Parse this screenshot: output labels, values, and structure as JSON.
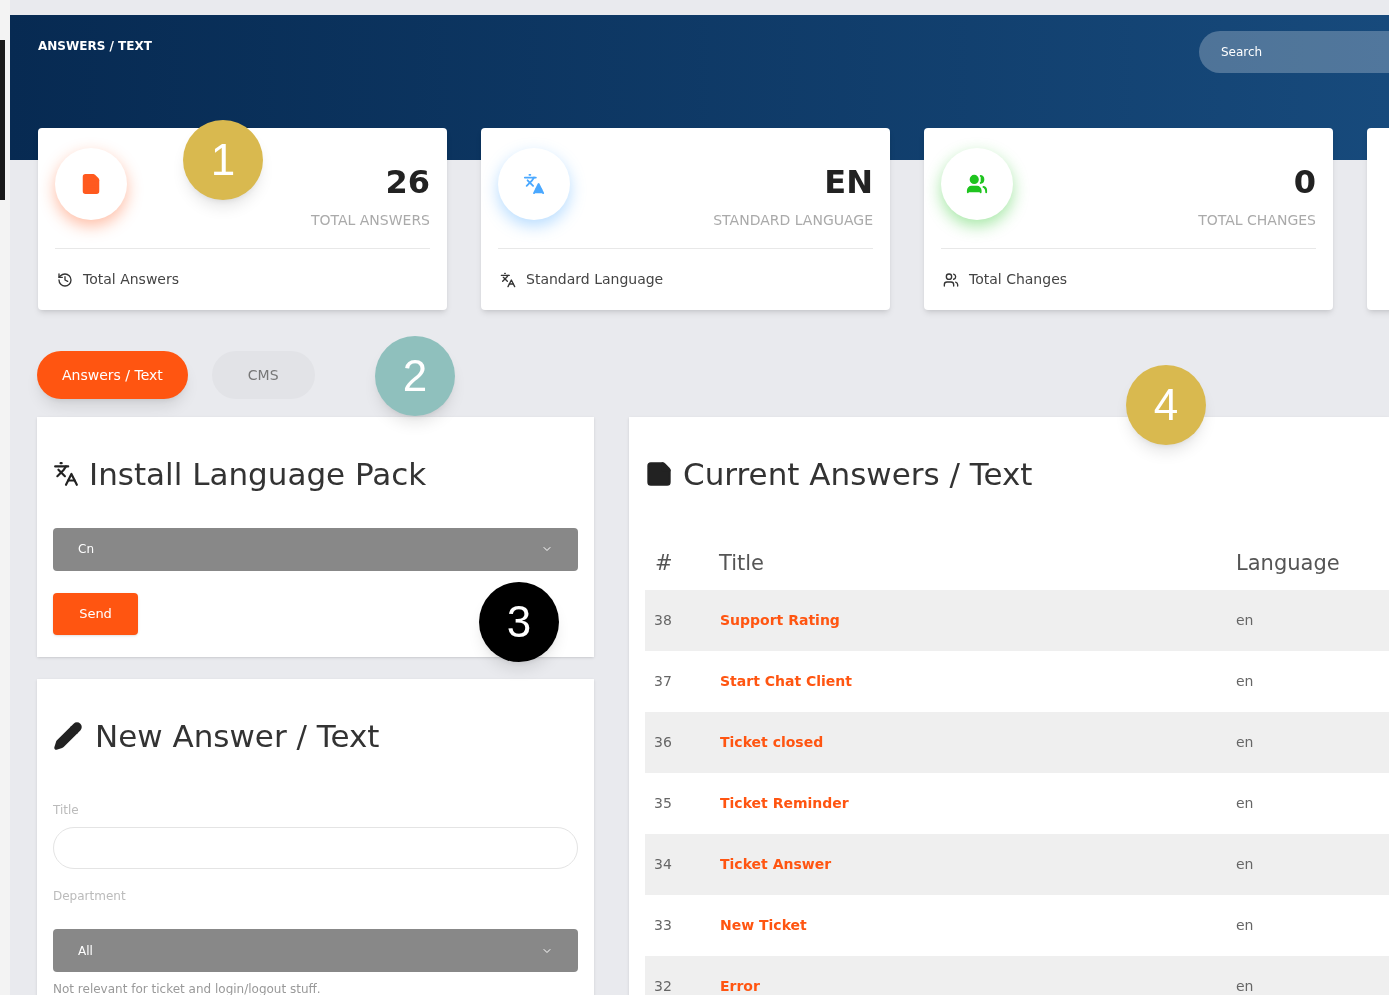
{
  "header": {
    "breadcrumb": "ANSWERS / TEXT",
    "search": {
      "placeholder": "Search"
    }
  },
  "stats": [
    {
      "value": "26",
      "label": "TOTAL ANSWERS",
      "footer": "Total Answers",
      "color": "#ff5a1f"
    },
    {
      "value": "EN",
      "label": "STANDARD LANGUAGE",
      "footer": "Standard Language",
      "color": "#4aa8ff"
    },
    {
      "value": "0",
      "label": "TOTAL CHANGES",
      "footer": "Total Changes",
      "color": "#1fc41f"
    }
  ],
  "tabs": [
    {
      "label": "Answers / Text",
      "selected": true
    },
    {
      "label": "CMS",
      "selected": false
    }
  ],
  "install_panel": {
    "title": "Install Language Pack",
    "select": "Cn",
    "button": "Send"
  },
  "new_panel": {
    "title": "New Answer / Text",
    "title_label": "Title",
    "department_label": "Department",
    "department": "All",
    "hint": "Not relevant for ticket and login/logout stuff."
  },
  "answers_panel": {
    "title": "Current Answers / Text",
    "columns": [
      "#",
      "Title",
      "Language"
    ],
    "rows": [
      {
        "id": "38",
        "title": "Support Rating",
        "language": "en"
      },
      {
        "id": "37",
        "title": "Start Chat Client",
        "language": "en"
      },
      {
        "id": "36",
        "title": "Ticket closed",
        "language": "en"
      },
      {
        "id": "35",
        "title": "Ticket Reminder",
        "language": "en"
      },
      {
        "id": "34",
        "title": "Ticket Answer",
        "language": "en"
      },
      {
        "id": "33",
        "title": "New Ticket",
        "language": "en"
      },
      {
        "id": "32",
        "title": "Error",
        "language": "en"
      }
    ]
  },
  "callouts": [
    {
      "label": "1",
      "color": "#d9b94f"
    },
    {
      "label": "2",
      "color": "#8fc0bd"
    },
    {
      "label": "3",
      "color": "#000000"
    },
    {
      "label": "4",
      "color": "#d9b94f"
    }
  ]
}
